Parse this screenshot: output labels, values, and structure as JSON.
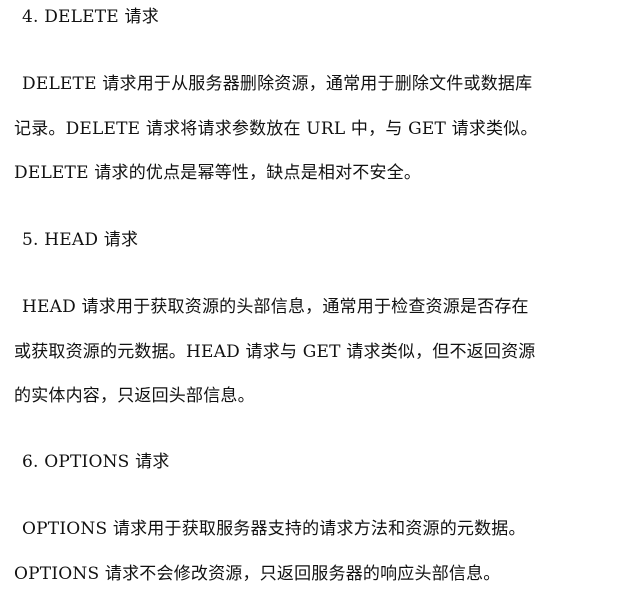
{
  "document": {
    "sections": [
      {
        "heading": "4. DELETE 请求",
        "lines": [
          "DELETE  请求用于从服务器删除资源，通常用于删除文件或数据库",
          "记录。DELETE  请求将请求参数放在  URL  中，与  GET  请求类似。",
          "DELETE 请求的优点是幂等性，缺点是相对不安全。"
        ]
      },
      {
        "heading": "5. HEAD 请求",
        "lines": [
          "HEAD  请求用于获取资源的头部信息，通常用于检查资源是否存在",
          "或获取资源的元数据。HEAD  请求与  GET  请求类似，但不返回资源",
          "的实体内容，只返回头部信息。"
        ]
      },
      {
        "heading": "6. OPTIONS 请求",
        "lines": [
          "OPTIONS  请求用于获取服务器支持的请求方法和资源的元数据。",
          "OPTIONS 请求不会修改资源，只返回服务器的响应头部信息。"
        ]
      }
    ]
  }
}
